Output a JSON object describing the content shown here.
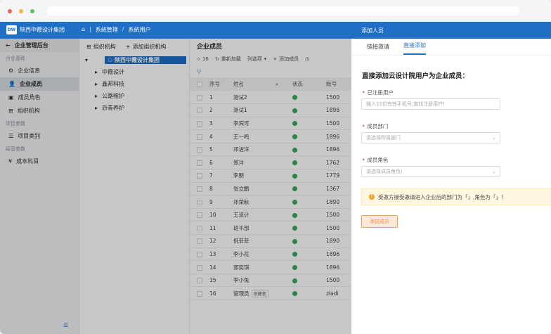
{
  "header": {
    "logo": "DW",
    "org_name": "陕西中霞设计集团",
    "breadcrumb": [
      "系统管理",
      "系统用户"
    ]
  },
  "sidebar": {
    "title": "企业管理后台",
    "groups": [
      {
        "label": "企业基础",
        "items": [
          {
            "label": "企业信息",
            "icon": "gear-icon",
            "active": false
          },
          {
            "label": "企业成员",
            "icon": "user-icon",
            "active": true
          },
          {
            "label": "成员角色",
            "icon": "id-card-icon",
            "active": false
          },
          {
            "label": "组织机构",
            "icon": "org-icon",
            "active": false
          }
        ]
      },
      {
        "label": "项目参数",
        "items": [
          {
            "label": "项目类别",
            "icon": "list-icon",
            "active": false
          }
        ]
      },
      {
        "label": "经营参数",
        "items": [
          {
            "label": "成本科目",
            "icon": "yen-icon",
            "active": false
          }
        ]
      }
    ]
  },
  "org_tree": {
    "title": "组织机构",
    "add_label": "添加组织机构",
    "root": "陕西中霞设计集团",
    "children": [
      "中霞设计",
      "鑫邦科技",
      "公路维护",
      "沥青养护"
    ]
  },
  "members": {
    "title": "企业成员",
    "tag_count": "16",
    "toolbar": [
      "重新加载",
      "列选项",
      "添加成员"
    ],
    "columns": [
      "序号",
      "姓名",
      "状态",
      "账号"
    ],
    "rows": [
      {
        "no": "1",
        "name": "测试2",
        "account": "1500"
      },
      {
        "no": "2",
        "name": "测试1",
        "account": "1896"
      },
      {
        "no": "3",
        "name": "李宾可",
        "account": "1500"
      },
      {
        "no": "4",
        "name": "王一鸣",
        "account": "1896"
      },
      {
        "no": "5",
        "name": "邓进洋",
        "account": "1896"
      },
      {
        "no": "6",
        "name": "郑沣",
        "account": "1762"
      },
      {
        "no": "7",
        "name": "李朋",
        "account": "1779"
      },
      {
        "no": "8",
        "name": "张立鹏",
        "account": "1367"
      },
      {
        "no": "9",
        "name": "邓荣秋",
        "account": "1890"
      },
      {
        "no": "10",
        "name": "王设计",
        "account": "1500"
      },
      {
        "no": "11",
        "name": "班干部",
        "account": "1500"
      },
      {
        "no": "12",
        "name": "倪菲菲",
        "account": "1890"
      },
      {
        "no": "13",
        "name": "李小花",
        "account": "1896"
      },
      {
        "no": "14",
        "name": "郭奕琪",
        "account": "1896"
      },
      {
        "no": "15",
        "name": "李小兔",
        "account": "1500"
      },
      {
        "no": "16",
        "name": "管理员",
        "badge": "创建者",
        "account": "zladi"
      }
    ]
  },
  "drawer": {
    "title": "添加人员",
    "tabs": [
      "链接邀请",
      "直接添加"
    ],
    "active_tab": 1,
    "subtitle": "直接添加云设计院用户为企业成员：",
    "fields": [
      {
        "label": "已注册用户",
        "placeholder": "输入11位有效手机号,查找注册用户!"
      },
      {
        "label": "成员部门",
        "placeholder": "请选择所属部门"
      },
      {
        "label": "成员角色",
        "placeholder": "请选择成员角色!"
      }
    ],
    "notice": "受邀方接受邀请进入企业后的部门为「」,角色为「」!",
    "submit_label": "添加成员"
  },
  "colors": {
    "brand": "#1f6fc8",
    "ok": "#36a95e",
    "warn": "#f0a020"
  }
}
